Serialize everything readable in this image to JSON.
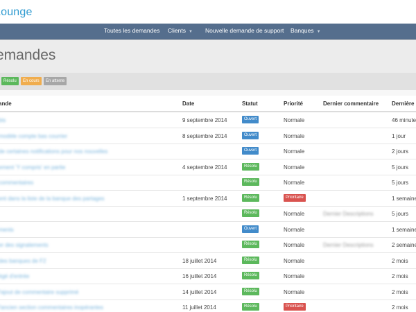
{
  "app": {
    "logo_text": "Lounge"
  },
  "nav": {
    "items": [
      {
        "label": "Toutes les demandes",
        "dropdown": false
      },
      {
        "label": "Clients",
        "dropdown": true
      },
      {
        "label": "Nouvelle demande de support",
        "dropdown": false
      },
      {
        "label": "Banques",
        "dropdown": true
      }
    ]
  },
  "page": {
    "title": "emandes"
  },
  "filters": [
    {
      "label": "Résolu",
      "color": "#5cb85c"
    },
    {
      "label": "En cours",
      "color": "#f0ad4e"
    },
    {
      "label": "En attente",
      "color": "#a7a7a7"
    }
  ],
  "table": {
    "columns": [
      "ande",
      "Date",
      "Statut",
      "Priorité",
      "Dernier commentaire",
      "Dernière m"
    ],
    "status_colors": {
      "Ouvert": "#428bca",
      "Résolu": "#5cb85c"
    },
    "priority_urgent_color": "#d9534f",
    "rows": [
      {
        "subject": "bis",
        "date": "9 septembre 2014",
        "status": "Ouvert",
        "priority": "Normale",
        "comment": "",
        "last": "46 minutes"
      },
      {
        "subject": "modèle compte bas courrier",
        "date": "8 septembre 2014",
        "status": "Ouvert",
        "priority": "Normale",
        "comment": "",
        "last": "1 jour"
      },
      {
        "subject": "de certaines notifications pour nos nouvelles",
        "date": "",
        "status": "Ouvert",
        "priority": "Normale",
        "comment": "",
        "last": "2 jours"
      },
      {
        "subject": "ement 'Y compris' en partie",
        "date": "4 septembre 2014",
        "status": "Résolu",
        "priority": "Normale",
        "comment": "",
        "last": "5 jours"
      },
      {
        "subject": "commentaires",
        "date": "",
        "status": "Résolu",
        "priority": "Normale",
        "comment": "",
        "last": "5 jours"
      },
      {
        "subject": "ent dans la liste de la banque des partages",
        "date": "1 septembre 2014",
        "status": "Résolu",
        "priority": "Prioritaire",
        "comment": "",
        "last": "1 semaine"
      },
      {
        "subject": "",
        "date": "",
        "status": "Résolu",
        "priority": "Normale",
        "comment": "Dernier Descriptions",
        "last": "5 jours"
      },
      {
        "subject": "ments",
        "date": "",
        "status": "Ouvert",
        "priority": "Normale",
        "comment": "",
        "last": "1 semaine"
      },
      {
        "subject": "er des signalements",
        "date": "",
        "status": "Résolu",
        "priority": "Normale",
        "comment": "Dernier Descriptions",
        "last": "2 semaines"
      },
      {
        "subject": "des banques de F2",
        "date": "18 juillet 2014",
        "status": "Résolu",
        "priority": "Normale",
        "comment": "",
        "last": "2 mois"
      },
      {
        "subject": "égé d'entrée",
        "date": "16 juillet 2014",
        "status": "Résolu",
        "priority": "Normale",
        "comment": "",
        "last": "2 mois"
      },
      {
        "subject": "l'ajout de commentaire supprimé",
        "date": "14 juillet 2014",
        "status": "Résolu",
        "priority": "Normale",
        "comment": "",
        "last": "2 mois"
      },
      {
        "subject": "l'ancien section commentaires inopérantes",
        "date": "11 juillet 2014",
        "status": "Résolu",
        "priority": "Prioritaire",
        "comment": "",
        "last": "2 mois"
      }
    ]
  }
}
